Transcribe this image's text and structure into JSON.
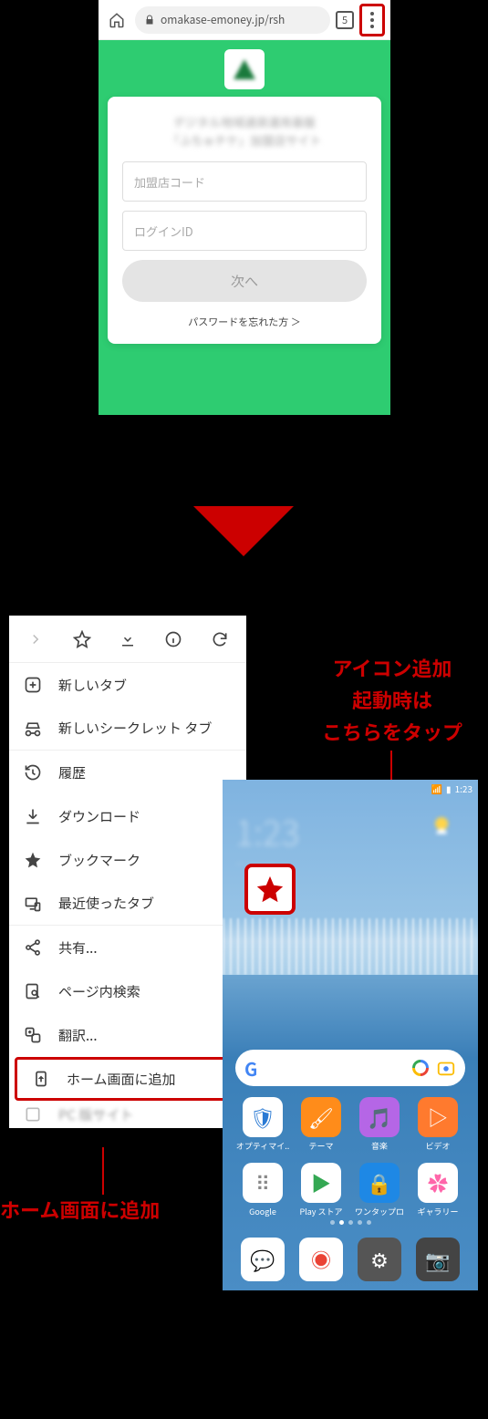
{
  "browser": {
    "url": "omakase-emoney.jp/rsh",
    "tab_count": "5",
    "header_line1": "デジタル地域通貨運用基盤",
    "header_line2": "「ふちゅチケ」加盟店サイト",
    "placeholder_code": "加盟店コード",
    "placeholder_id": "ログインID",
    "next_btn": "次へ",
    "forgot": "パスワードを忘れた方 ＞"
  },
  "menu": {
    "items": {
      "new_tab": "新しいタブ",
      "incognito": "新しいシークレット タブ",
      "history": "履歴",
      "downloads": "ダウンロード",
      "bookmarks": "ブックマーク",
      "recent": "最近使ったタブ",
      "share": "共有...",
      "find": "ページ内検索",
      "translate": "翻訳...",
      "add_home": "ホーム画面に追加",
      "desktop": "PC 版サイト"
    }
  },
  "labels": {
    "instruction_l1": "アイコン追加",
    "instruction_l2": "起動時は",
    "instruction_l3": "こちらをタップ",
    "add_home_callout": "ホーム画面に追加"
  },
  "home": {
    "status_time": "1:23",
    "clock": "1:23",
    "apps": [
      {
        "label": "オプティマイ..",
        "color": "#fff",
        "glyph": "🛡",
        "fg": "#2a7ad4"
      },
      {
        "label": "テーマ",
        "color": "#ff8c1a",
        "glyph": "🖌"
      },
      {
        "label": "音楽",
        "color": "#b566e6",
        "glyph": "🎵"
      },
      {
        "label": "ビデオ",
        "color": "#ff7a2e",
        "glyph": "▷"
      },
      {
        "label": "Google",
        "color": "#fff",
        "glyph": "⠿",
        "fg": "#888"
      },
      {
        "label": "Play ストア",
        "color": "#fff",
        "glyph": "▶",
        "fg": "#34a853"
      },
      {
        "label": "ワンタップロ",
        "color": "#1e88e5",
        "glyph": "🔒"
      },
      {
        "label": "ギャラリー",
        "color": "#fff",
        "glyph": "✿",
        "fg": "#f6a"
      }
    ],
    "dock": [
      {
        "name": "messages",
        "color": "#fff",
        "glyph": "💬",
        "fg": "#2a7ad4"
      },
      {
        "name": "chrome",
        "color": "#fff",
        "glyph": "◉",
        "fg": "#ea4335"
      },
      {
        "name": "settings",
        "color": "#555",
        "glyph": "⚙"
      },
      {
        "name": "camera",
        "color": "#444",
        "glyph": "📷"
      }
    ]
  }
}
